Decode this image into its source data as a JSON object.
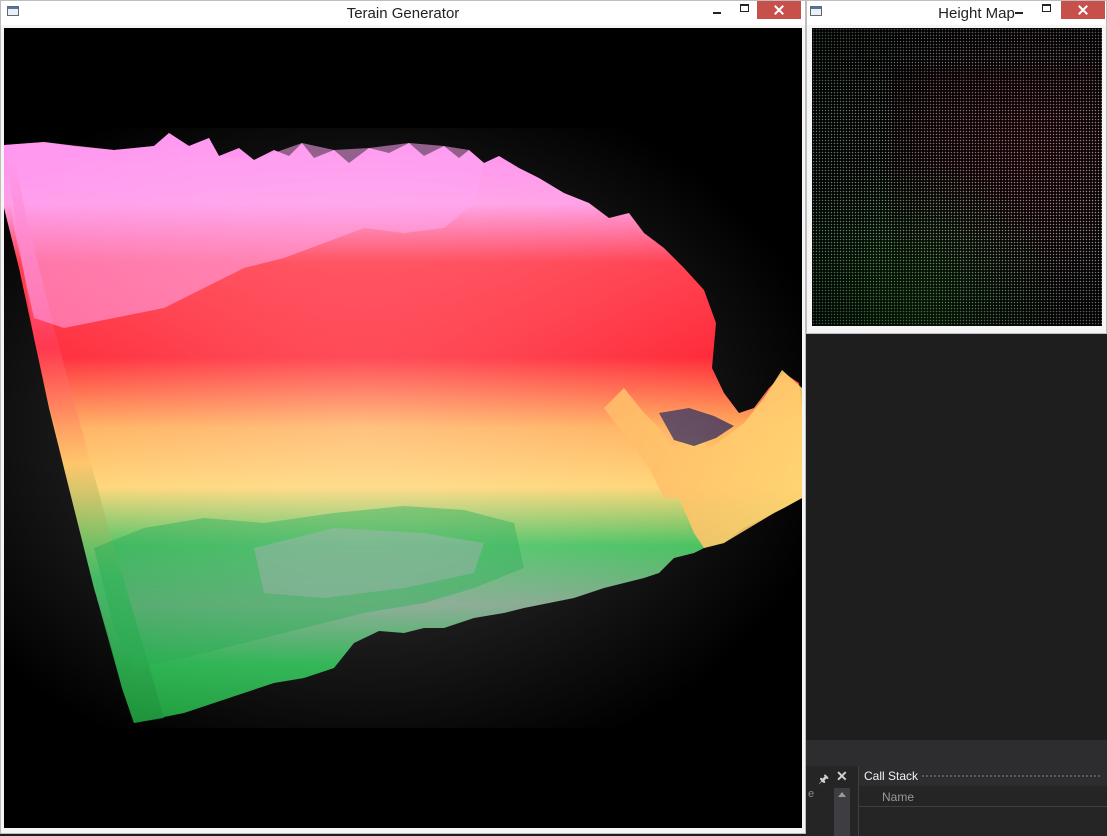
{
  "terrain_window": {
    "title": "Terain Generator",
    "controls": [
      "minimize",
      "maximize",
      "close"
    ]
  },
  "heightmap_window": {
    "title": "Height Map",
    "controls": [
      "minimize",
      "maximize",
      "close"
    ]
  },
  "ide": {
    "call_stack_title": "Call Stack",
    "call_stack_column": "Name",
    "left_panel_fragment": "e"
  },
  "icons": {
    "app": "window-app-icon",
    "pin": "pin-icon",
    "close": "close-icon"
  },
  "colors": {
    "titlebar_bg": "#ffffff",
    "close_button": "#c7504a",
    "render_bg": "#000000",
    "ide_bg": "#1e1e1e",
    "terrain_band_peak": "#ff8cf0",
    "terrain_band_high": "#ff1e2e",
    "terrain_band_mid": "#ffcf6a",
    "terrain_band_low": "#1aa844"
  }
}
